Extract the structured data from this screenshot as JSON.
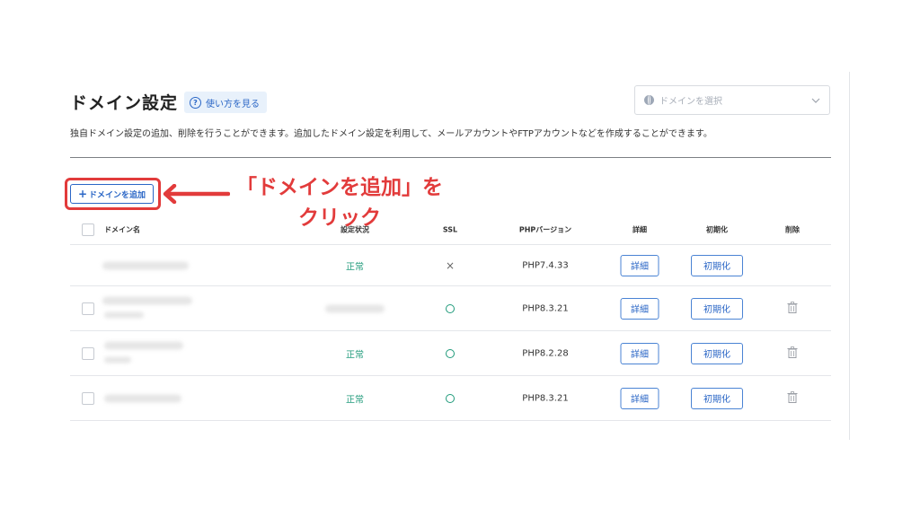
{
  "header": {
    "title": "ドメイン設定",
    "help_label": "使い方を見る",
    "domain_select_placeholder": "ドメインを選択"
  },
  "description": "独自ドメイン設定の追加、削除を行うことができます。追加したドメイン設定を利用して、メールアカウントやFTPアカウントなどを作成することができます。",
  "add_button_label": "ドメインを追加",
  "annotation": {
    "line1": "「ドメインを追加」を",
    "line2": "クリック",
    "color": "#e23b3b"
  },
  "table": {
    "columns": {
      "domain": "ドメイン名",
      "status": "設定状況",
      "ssl": "SSL",
      "php": "PHPバージョン",
      "detail": "詳細",
      "init": "初期化",
      "delete": "削除"
    },
    "rows": [
      {
        "status": "正常",
        "ssl": "×",
        "php": "PHP7.4.33",
        "detail": "詳細",
        "init": "初期化"
      },
      {
        "status": "",
        "ssl": "○",
        "php": "PHP8.3.21",
        "detail": "詳細",
        "init": "初期化"
      },
      {
        "status": "正常",
        "ssl": "○",
        "php": "PHP8.2.28",
        "detail": "詳細",
        "init": "初期化"
      },
      {
        "status": "正常",
        "ssl": "○",
        "php": "PHP8.3.21",
        "detail": "詳細",
        "init": "初期化"
      }
    ]
  },
  "colors": {
    "accent": "#2a66c6",
    "ok": "#1f9a7a",
    "highlight": "#e23b3b"
  }
}
